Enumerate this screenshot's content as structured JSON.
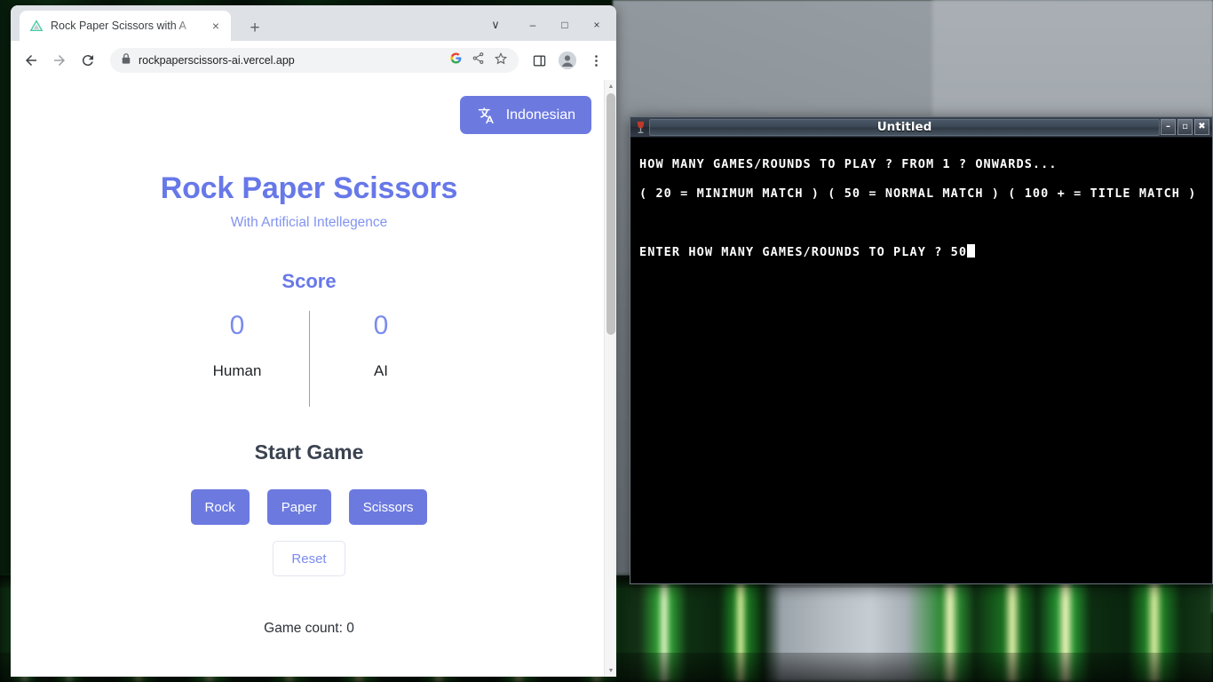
{
  "browser": {
    "tab": {
      "title": "Rock Paper Scissors with A",
      "favicon_name": "vercel-triangle-icon",
      "close_label": "×"
    },
    "newtab_label": "+",
    "window_controls": {
      "chevron": "∨",
      "minimize": "–",
      "maximize": "□",
      "close": "×"
    },
    "toolbar": {
      "back": "←",
      "forward": "→",
      "reload": "⟳",
      "lock_icon": "lock-icon",
      "url": "rockpaperscissors-ai.vercel.app",
      "google_icon": "google-icon",
      "share_icon": "share-icon",
      "bookmark_icon": "star-icon",
      "side_panel_icon": "side-panel-icon",
      "profile_icon": "profile-avatar-icon",
      "menu_icon": "three-dot-menu-icon"
    },
    "scrollbar": {
      "up_arrow": "▲",
      "down_arrow": "▼"
    }
  },
  "page": {
    "language_button": "Indonesian",
    "title": "Rock Paper Scissors",
    "subtitle": "With Artificial Intellegence",
    "score_heading": "Score",
    "scores": [
      {
        "value": "0",
        "label": "Human"
      },
      {
        "value": "0",
        "label": "AI"
      }
    ],
    "start_heading": "Start Game",
    "choices": [
      "Rock",
      "Paper",
      "Scissors"
    ],
    "reset_label": "Reset",
    "game_count": "Game count: 0",
    "accent_color": "#6c7ae0",
    "title_color": "#6778e8"
  },
  "terminal": {
    "window_title": "Untitled",
    "icon_name": "wine-glass-icon",
    "controls": {
      "minimize": "–",
      "maximize": "▫",
      "close": "✖"
    },
    "lines": [
      "HOW MANY GAMES/ROUNDS TO PLAY ? FROM 1 ? ONWARDS...",
      "( 20 = MINIMUM MATCH ) ( 50 = NORMAL MATCH ) ( 100 + = TITLE MATCH )",
      "",
      "ENTER HOW MANY GAMES/ROUNDS TO PLAY ? 50"
    ],
    "input_value": "50",
    "bg_color": "#000000",
    "fg_color": "#ffffff"
  }
}
